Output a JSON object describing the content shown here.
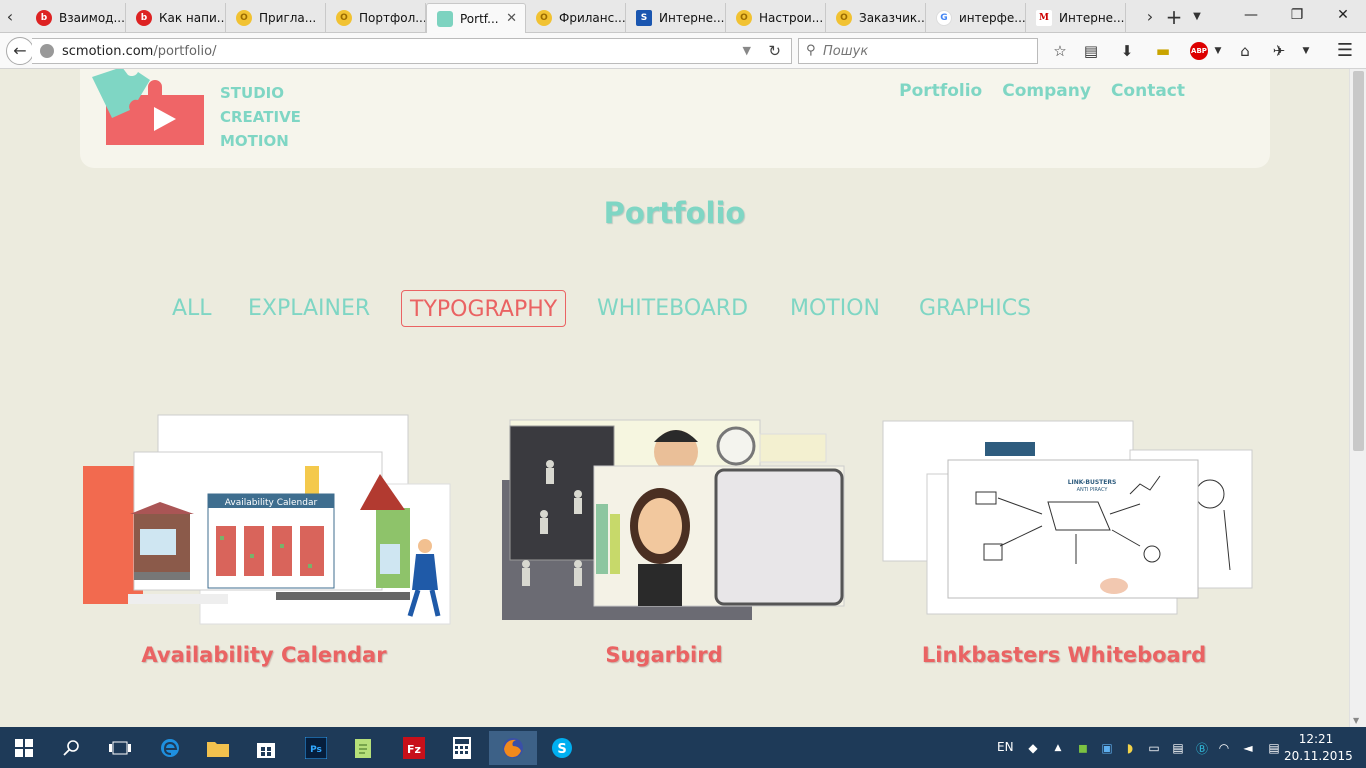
{
  "browser": {
    "tabs": [
      {
        "title": "Взаимод...",
        "icon": "opera-icon",
        "active": false
      },
      {
        "title": "Как напи...",
        "icon": "opera-icon",
        "active": false
      },
      {
        "title": "Пригла...",
        "icon": "coin-icon",
        "active": false
      },
      {
        "title": "Портфол...",
        "icon": "coin-icon",
        "active": false
      },
      {
        "title": "Portf...",
        "icon": "scmotion-icon",
        "active": true
      },
      {
        "title": "Фриланс...",
        "icon": "coin-icon",
        "active": false
      },
      {
        "title": "Интерне...",
        "icon": "blue-flag-icon",
        "active": false
      },
      {
        "title": "Настрои...",
        "icon": "coin-icon",
        "active": false
      },
      {
        "title": "Заказчик...",
        "icon": "coin-icon",
        "active": false
      },
      {
        "title": "интерфе...",
        "icon": "google-icon",
        "active": false
      },
      {
        "title": "Интерне...",
        "icon": "gmail-icon",
        "active": false
      }
    ],
    "url_host": "scmotion.com",
    "url_path": "/portfolio/",
    "search_placeholder": "Пошук",
    "abp_label": "ABP"
  },
  "site": {
    "logo_lines": [
      "STUDIO",
      "CREATIVE",
      "MOTION"
    ],
    "nav": [
      "Portfolio",
      "Company",
      "Contact"
    ],
    "page_title": "Portfolio",
    "filters": [
      {
        "label": "ALL",
        "active": false
      },
      {
        "label": "EXPLAINER",
        "active": false
      },
      {
        "label": "TYPOGRAPHY",
        "active": true
      },
      {
        "label": "WHITEBOARD",
        "active": false
      },
      {
        "label": "MOTION",
        "active": false
      },
      {
        "label": "GRAPHICS",
        "active": false
      }
    ],
    "projects": [
      {
        "title": "Availability Calendar",
        "thumb_caption": "Availability Calendar"
      },
      {
        "title": "Sugarbird"
      },
      {
        "title": "Linkbasters Whiteboard",
        "thumb_caption": "LINK-BUSTERS",
        "thumb_subcaption": "ANTI PIRACY"
      }
    ]
  },
  "colors": {
    "accent_teal": "#7fd6c4",
    "accent_red": "#ea6363",
    "page_bg": "#ecebde",
    "header_bg": "#f6f5ec",
    "taskbar_bg": "#1e3a58"
  },
  "taskbar": {
    "lang": "EN",
    "time": "12:21",
    "date": "20.11.2015",
    "apps": [
      "windows-start-icon",
      "search-icon",
      "task-view-icon",
      "edge-icon",
      "file-explorer-icon",
      "store-icon",
      "photoshop-icon",
      "notepadpp-icon",
      "filezilla-icon",
      "calculator-icon",
      "firefox-icon",
      "skype-icon"
    ]
  }
}
